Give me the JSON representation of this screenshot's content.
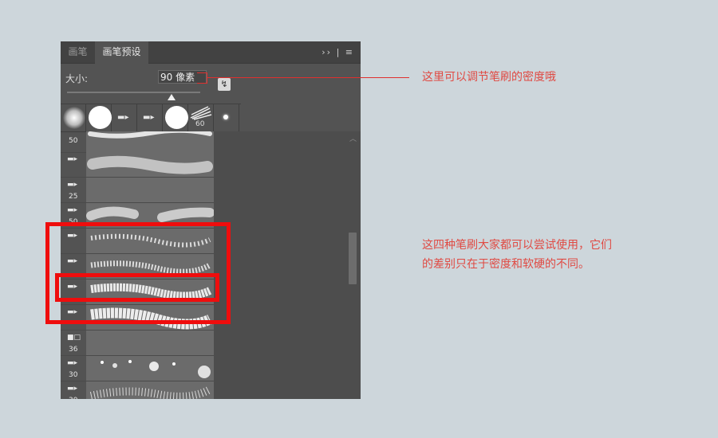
{
  "panel": {
    "tabs": [
      {
        "label": "画笔"
      },
      {
        "label": "画笔预设"
      }
    ],
    "menu_icons": "›› | ≡",
    "size_label": "大小:",
    "size_value": "90 像素",
    "size_slider_fraction": 0.8,
    "quick_presets": [
      {
        "kind": "soft-round"
      },
      {
        "kind": "hard-round"
      },
      {
        "kind": "brush-tip"
      },
      {
        "kind": "brush-tip"
      },
      {
        "kind": "hard-round"
      },
      {
        "kind": "textured",
        "size": "60"
      },
      {
        "kind": "small-dot"
      }
    ],
    "presets": [
      {
        "size": "50",
        "stroke": "wavy-solid"
      },
      {
        "size": "",
        "stroke": "cloudy"
      },
      {
        "size": "25",
        "stroke": "faint"
      },
      {
        "size": "50",
        "stroke": "cloudy-break"
      },
      {
        "size": "",
        "stroke": "spray-fine"
      },
      {
        "size": "",
        "stroke": "spray-fine"
      },
      {
        "size": "",
        "stroke": "spray-medium"
      },
      {
        "size": "",
        "stroke": "spray-dense"
      },
      {
        "size": "36",
        "stroke": "faint"
      },
      {
        "size": "30",
        "stroke": "bokeh"
      },
      {
        "size": "30",
        "stroke": "confetti"
      }
    ]
  },
  "annotations": {
    "size_note": "这里可以调节笔刷的密度哦",
    "brush_note": "这四种笔刷大家都可以尝试使用，它们的差别只在于密度和软硬的不同。"
  },
  "colors": {
    "annotation": "#e04a43",
    "highlight": "#ef0d0d",
    "panel_bg": "#535353"
  }
}
